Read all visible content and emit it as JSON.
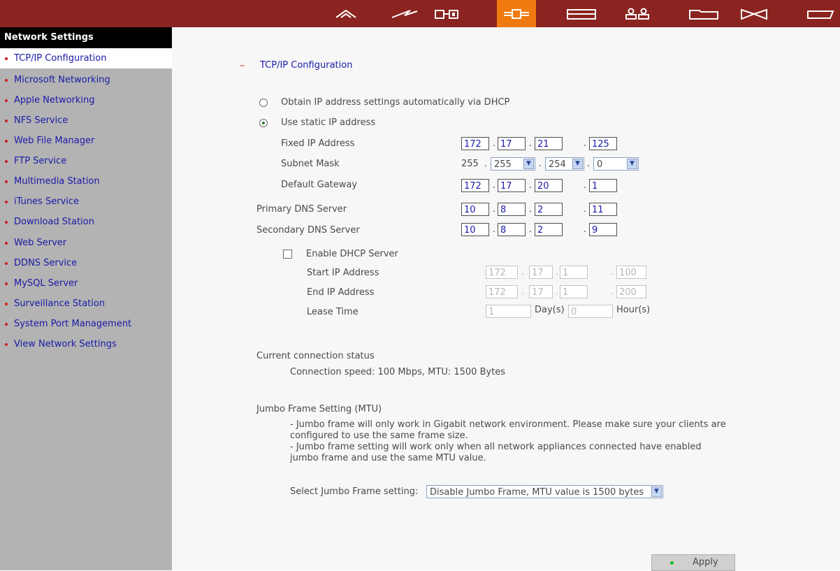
{
  "nav": {
    "icons": [
      "home-icon",
      "system-icon",
      "disk-icon",
      "network-icon",
      "device-icon",
      "users-icon",
      "folder-icon",
      "share-icon",
      "tag-icon"
    ],
    "active_icon": "network-icon",
    "colors": {
      "bar": "#8b2420",
      "active": "#f07a10",
      "icon": "#ffffff"
    }
  },
  "sidebar": {
    "title": "Network Settings",
    "items": [
      {
        "label": "TCP/IP Configuration",
        "active": true
      },
      {
        "label": "Microsoft Networking"
      },
      {
        "label": "Apple Networking"
      },
      {
        "label": "NFS Service"
      },
      {
        "label": "Web File Manager"
      },
      {
        "label": "FTP Service"
      },
      {
        "label": "Multimedia Station"
      },
      {
        "label": "iTunes Service"
      },
      {
        "label": "Download Station"
      },
      {
        "label": "Web Server"
      },
      {
        "label": "DDNS Service"
      },
      {
        "label": "MySQL Server"
      },
      {
        "label": "Surveillance Station"
      },
      {
        "label": "System Port Management"
      },
      {
        "label": "View Network Settings"
      }
    ]
  },
  "section": {
    "collapse_mark": "–",
    "title": "TCP/IP Configuration"
  },
  "ip_mode": {
    "dhcp_label": "Obtain IP address settings automatically via DHCP",
    "static_label": "Use static IP address",
    "selected": "static"
  },
  "fixed_ip": {
    "label": "Fixed IP Address",
    "octets": [
      "172",
      "17",
      "21",
      "125"
    ]
  },
  "subnet": {
    "label": "Subnet Mask",
    "first": "255",
    "selects": [
      "255",
      "254",
      "0"
    ]
  },
  "gateway": {
    "label": "Default Gateway",
    "octets": [
      "172",
      "17",
      "20",
      "1"
    ]
  },
  "dns1": {
    "label": "Primary DNS Server",
    "octets": [
      "10",
      "8",
      "2",
      "11"
    ]
  },
  "dns2": {
    "label": "Secondary DNS Server",
    "octets": [
      "10",
      "8",
      "2",
      "9"
    ]
  },
  "dhcp_server": {
    "enable_label": "Enable DHCP Server",
    "enabled": false,
    "start_label": "Start IP Address",
    "start_octets": [
      "172",
      "17",
      "1",
      "100"
    ],
    "end_label": "End IP Address",
    "end_octets": [
      "172",
      "17",
      "1",
      "200"
    ],
    "lease_label": "Lease Time",
    "lease_days": "1",
    "days_unit": "Day(s)",
    "lease_hours": "0",
    "hours_unit": "Hour(s)"
  },
  "status": {
    "title": "Current connection status",
    "text": "Connection speed: 100 Mbps, MTU: 1500 Bytes"
  },
  "jumbo": {
    "title": "Jumbo Frame Setting (MTU)",
    "line1": "- Jumbo frame will only work in Gigabit network environment. Please make sure your clients are",
    "line2": "configured to use the same frame size.",
    "line3": "- Jumbo frame setting will work only when all network appliances connected have enabled",
    "line4": "jumbo frame and use the same MTU value.",
    "select_label": "Select Jumbo Frame setting:",
    "select_value": "Disable Jumbo Frame, MTU value is 1500 bytes"
  },
  "apply_label": "Apply"
}
